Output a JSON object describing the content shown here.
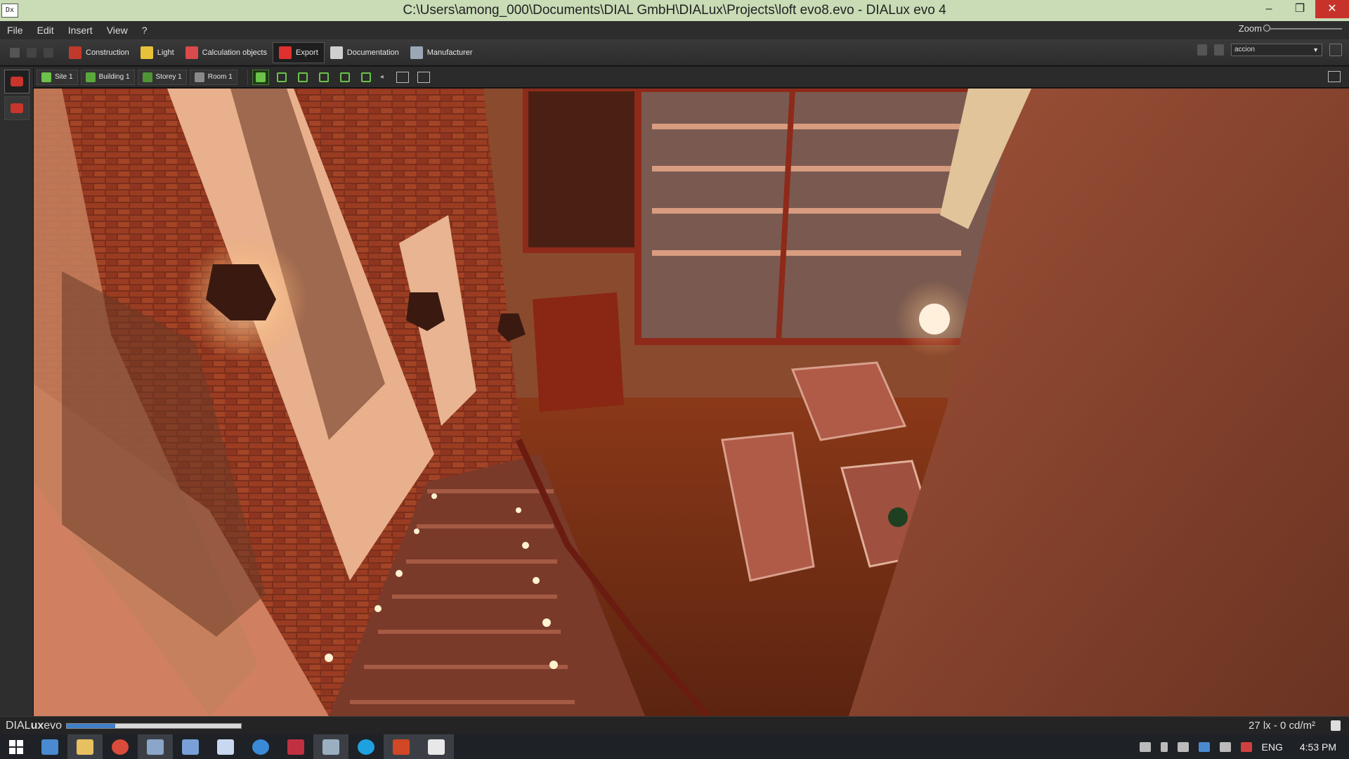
{
  "window": {
    "app_icon": "Dx",
    "title": "C:\\Users\\among_000\\Documents\\DIAL GmbH\\DIALux\\Projects\\loft evo8.evo - DIALux evo 4",
    "min_glyph": "–",
    "max_glyph": "❐",
    "close_glyph": "✕"
  },
  "menu": {
    "items": [
      "File",
      "Edit",
      "Insert",
      "View",
      "?"
    ],
    "zoom_label": "Zoom"
  },
  "toolbar": {
    "modes": [
      {
        "label": "Construction",
        "icon": "construction-icon",
        "color": "#c0392b"
      },
      {
        "label": "Light",
        "icon": "light-icon",
        "color": "#e8c13a"
      },
      {
        "label": "Calculation objects",
        "icon": "calculation-objects-icon",
        "color": "#d94a4a"
      },
      {
        "label": "Export",
        "icon": "export-icon",
        "color": "#e03030",
        "active": true
      },
      {
        "label": "Documentation",
        "icon": "documentation-icon",
        "color": "#cfcfcf"
      },
      {
        "label": "Manufacturer",
        "icon": "manufacturer-icon",
        "color": "#9aa7b5"
      }
    ],
    "catalog_select": "accion"
  },
  "navigation": {
    "crumbs": [
      {
        "label": "Site 1",
        "icon": "site-icon"
      },
      {
        "label": "Building 1",
        "icon": "building-icon"
      },
      {
        "label": "Storey 1",
        "icon": "storey-icon"
      },
      {
        "label": "Room 1",
        "icon": "room-icon"
      }
    ]
  },
  "status": {
    "brand_prefix": "DIAL",
    "brand_bold": "ux",
    "brand_suffix": "evo",
    "progress_fraction": 0.28,
    "readout": "27 lx - 0 cd/m²"
  },
  "taskbar": {
    "tray_language": "ENG",
    "clock": "4:53 PM"
  },
  "colors": {
    "accent_green": "#6cc24a",
    "close_red": "#c7332b",
    "title_bar": "#c9dcb6"
  }
}
